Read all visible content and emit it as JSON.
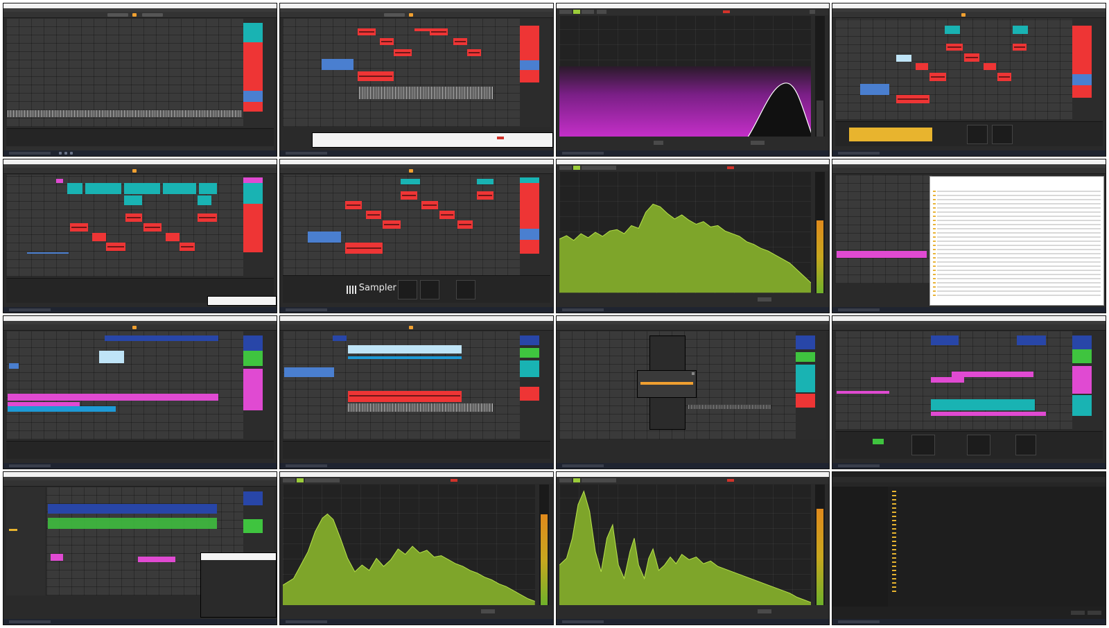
{
  "grid_title": "",
  "sampler": {
    "label": "Sampler"
  },
  "colors": {
    "red_clip": "#ee3535",
    "blue_clip": "#4a7fd0",
    "teal_clip": "#19b3b3",
    "pink_clip": "#e04ad2",
    "green_clip": "#3fc43f",
    "lightblue_clip": "#bfe4f7",
    "yellow_clip": "#e8b42e",
    "accent_orange": "#f0a030",
    "analyzer_green": "#8fbf2a",
    "analyzer_purple": "#c42fc8",
    "analyzer_logo": "#d2332a"
  },
  "icons": {
    "window_close": "close-icon",
    "start_menu": "windows-start-icon",
    "search": "search-icon",
    "folder": "folder-icon"
  },
  "thumbnails": [
    {
      "id": "t1",
      "kind": "daw-arrangement"
    },
    {
      "id": "t2",
      "kind": "daw-midi-editor"
    },
    {
      "id": "t3",
      "kind": "analyzer-purple"
    },
    {
      "id": "t4",
      "kind": "daw-midi-editor"
    },
    {
      "id": "t5",
      "kind": "daw-midi-editor"
    },
    {
      "id": "t6",
      "kind": "daw-sampler"
    },
    {
      "id": "t7",
      "kind": "analyzer-green"
    },
    {
      "id": "t8",
      "kind": "daw-file-browser"
    },
    {
      "id": "t9",
      "kind": "daw-arrangement"
    },
    {
      "id": "t10",
      "kind": "daw-arrangement"
    },
    {
      "id": "t11",
      "kind": "daw-context-menu"
    },
    {
      "id": "t12",
      "kind": "daw-arrangement"
    },
    {
      "id": "t13",
      "kind": "daw-browser"
    },
    {
      "id": "t14",
      "kind": "analyzer-green"
    },
    {
      "id": "t15",
      "kind": "analyzer-green"
    },
    {
      "id": "t16",
      "kind": "file-explorer"
    }
  ]
}
